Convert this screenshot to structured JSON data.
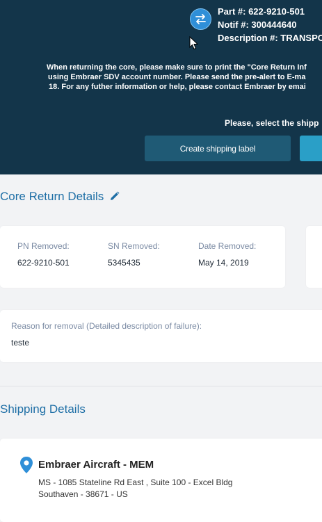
{
  "header": {
    "part_number": "Part #: 622-9210-501",
    "notif_number": "Notif #: 300444640",
    "description": "Description #: TRANSPO",
    "notice_lines": [
      "When returning the core, please make sure to print the \"Core Return Inf",
      "using Embraer SDV account number. Please send the pre-alert to E-ma",
      "18. For any futher information or help, please contact Embraer by emai"
    ],
    "select_prompt": "Please, select the shipp",
    "create_label_button": "Create shipping label",
    "swap_icon": "swap-arrows-icon",
    "accent_color": "#2f8fd8",
    "background_color": "#13354a"
  },
  "core_return": {
    "title": "Core Return Details",
    "edit_icon": "pencil-icon",
    "pn_label": "PN Removed:",
    "pn_value": "622-9210-501",
    "sn_label": "SN Removed:",
    "sn_value": "5345435",
    "date_label": "Date Removed:",
    "date_value": "May 14, 2019",
    "reason_label": "Reason for removal (Detailed description of failure):",
    "reason_value": "teste"
  },
  "shipping": {
    "title": "Shipping Details",
    "location_icon": "map-pin-icon",
    "name": "Embraer Aircraft - MEM",
    "address_line1": "MS - 1085 Stateline Rd East , Suite 100 - Excel Bldg",
    "address_line2": "Southaven - 38671 - US"
  }
}
